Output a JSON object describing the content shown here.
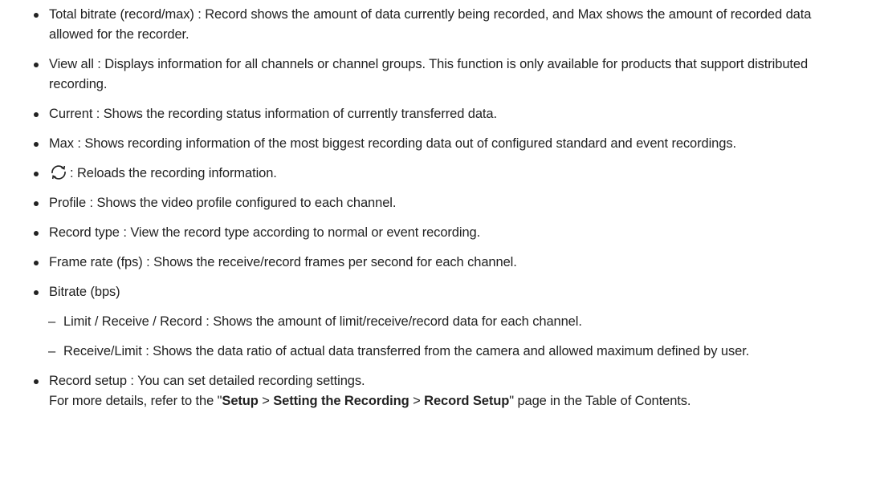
{
  "items": [
    {
      "text": "Total bitrate (record/max) : Record shows the amount of data currently being recorded, and Max shows the amount of recorded data allowed for the recorder."
    },
    {
      "text": "View all : Displays information for all channels or channel groups. This function is only available for products that support distributed recording."
    },
    {
      "text": "Current : Shows the recording status information of currently transferred data."
    },
    {
      "text": "Max : Shows recording information of the most biggest recording data out of configured standard and event recordings."
    },
    {
      "icon": "refresh-icon",
      "text": ": Reloads the recording information."
    },
    {
      "text": "Profile : Shows the video profile configured to each channel."
    },
    {
      "text": "Record type : View the record type according to normal or event recording."
    },
    {
      "text": "Frame rate (fps) : Shows the receive/record frames per second for each channel."
    },
    {
      "text": "Bitrate (bps)",
      "subitems": [
        {
          "dash": "–",
          "text": "Limit / Receive / Record : Shows the amount of limit/receive/record data for each channel."
        },
        {
          "dash": "–",
          "text": "Receive/Limit : Shows the data ratio of actual data transferred from the camera and allowed maximum defined by user."
        }
      ]
    },
    {
      "text": "Record setup : You can set detailed recording settings.",
      "ref": {
        "prefix": "For more details, refer to the \"",
        "part1": "Setup",
        "sep1": " > ",
        "part2": "Setting the Recording",
        "sep2": " > ",
        "part3": "Record Setup",
        "suffix": "\" page in the Table of Contents."
      }
    }
  ]
}
